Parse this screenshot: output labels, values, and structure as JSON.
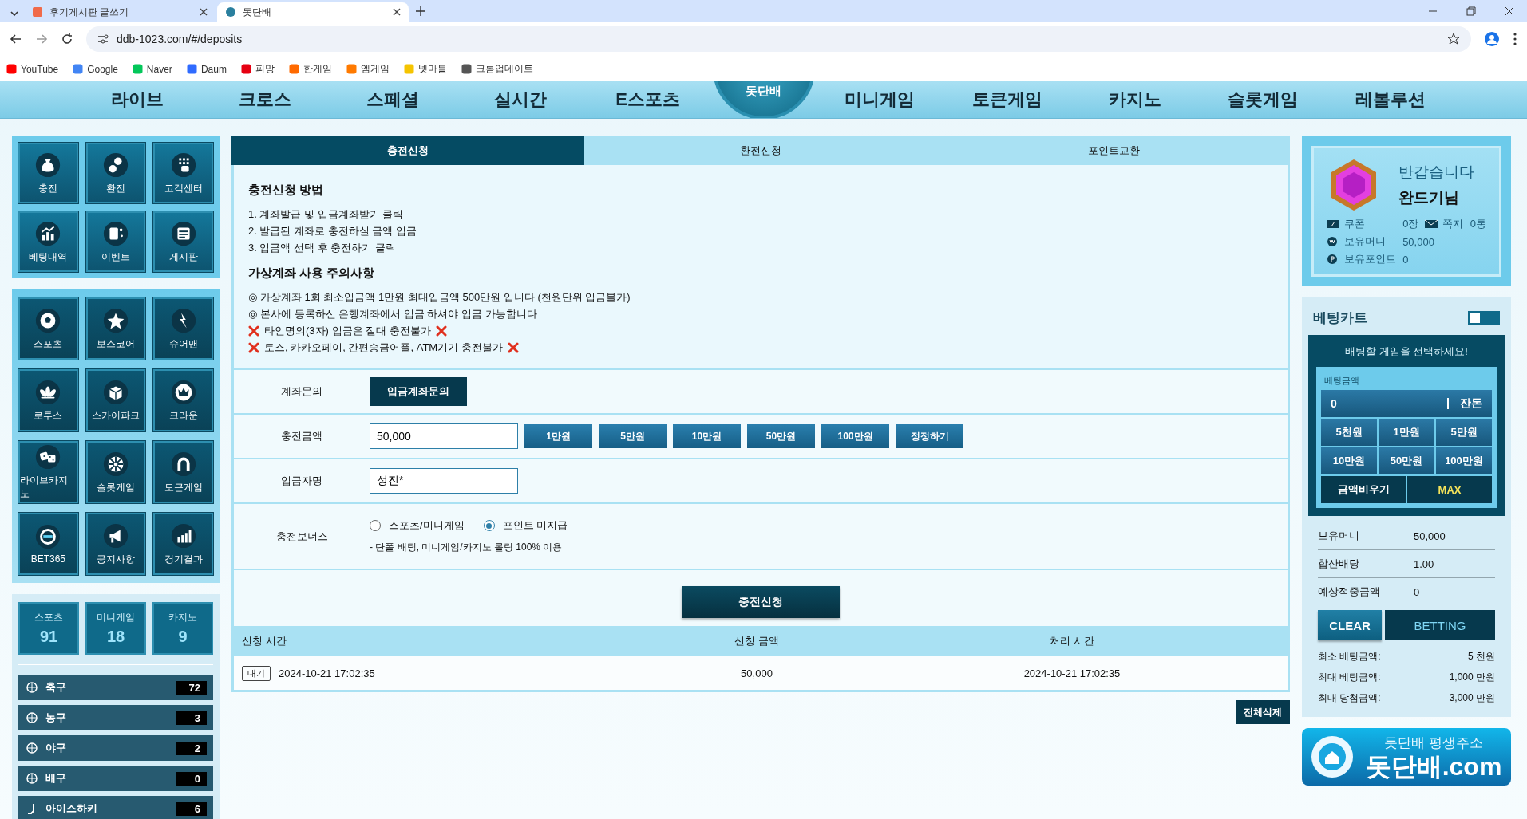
{
  "browser": {
    "tabs": [
      {
        "title": "후기게시판 글쓰기",
        "selected": false
      },
      {
        "title": "돗단배",
        "selected": true
      }
    ],
    "url": "ddb-1023.com/#/deposits",
    "bookmarks": [
      "YouTube",
      "Google",
      "Naver",
      "Daum",
      "피망",
      "한게임",
      "엠게임",
      "넷마블",
      "크롬업데이트"
    ]
  },
  "nav": {
    "items_left": [
      "라이브",
      "크로스",
      "스페셜",
      "실시간",
      "E스포츠"
    ],
    "logo": "돗단배",
    "items_right": [
      "미니게임",
      "토큰게임",
      "카지노",
      "슬롯게임",
      "레볼루션"
    ]
  },
  "sidebar": {
    "menu": [
      "충전",
      "환전",
      "고객센터",
      "베팅내역",
      "이벤트",
      "게시판"
    ],
    "games": [
      "스포츠",
      "보스코어",
      "슈어맨",
      "로투스",
      "스카이파크",
      "크라운",
      "라이브카지노",
      "슬롯게임",
      "토큰게임",
      "BET365",
      "공지사항",
      "경기결과"
    ],
    "counts": [
      {
        "label": "스포츠",
        "value": "91"
      },
      {
        "label": "미니게임",
        "value": "18"
      },
      {
        "label": "카지노",
        "value": "9"
      }
    ],
    "sports": [
      {
        "name": "축구",
        "count": "72"
      },
      {
        "name": "농구",
        "count": "3"
      },
      {
        "name": "야구",
        "count": "2"
      },
      {
        "name": "배구",
        "count": "0"
      },
      {
        "name": "아이스하키",
        "count": "6"
      }
    ]
  },
  "tabs": [
    {
      "label": "충전신청",
      "selected": true
    },
    {
      "label": "환전신청",
      "selected": false
    },
    {
      "label": "포인트교환",
      "selected": false
    }
  ],
  "guide": {
    "title": "충전신청 방법",
    "steps": [
      "1. 계좌발급 및 입금계좌받기 클릭",
      "2. 발급된 계좌로 충전하실 금액 입금",
      "3. 입금액 선택 후 충전하기 클릭"
    ],
    "notice_title": "가상계좌 사용 주의사항",
    "notices": [
      {
        "kind": "info",
        "text": "◎ 가상계좌 1회 최소입금액 1만원 최대입금액 500만원 입니다 (천원단위 입금불가)"
      },
      {
        "kind": "info",
        "text": "◎ 본사에 등록하신 은행계좌에서 입금 하셔야 입금 가능합니다"
      },
      {
        "kind": "warning",
        "text": "타인명의(3자) 입금은 절대 충전불가"
      },
      {
        "kind": "warning",
        "text": "토스, 카카오페이, 간편송금어플, ATM기기 충전불가"
      }
    ]
  },
  "form": [
    {
      "kind": "button",
      "label": "계좌문의",
      "button": "입금계좌문의"
    },
    {
      "kind": "amount",
      "label": "충전금액",
      "value": "50,000",
      "buttons": [
        "1만원",
        "5만원",
        "10만원",
        "50만원",
        "100만원",
        "정정하기"
      ]
    },
    {
      "kind": "text",
      "label": "입금자명",
      "value": "성진*"
    },
    {
      "kind": "radio",
      "label": "충전보너스",
      "options": [
        {
          "label": "스포츠/미니게임",
          "selected": false
        },
        {
          "label": "포인트 미지급",
          "selected": true
        }
      ],
      "note": "- 단폴 배팅, 미니게임/카지노 롤링 100% 이용"
    }
  ],
  "submit": "충전신청",
  "history": {
    "columns": [
      "신청 시간",
      "신청 금액",
      "처리 시간"
    ],
    "rows": [
      {
        "status": "대기",
        "requested": "2024-10-21 17:02:35",
        "amount": "50,000",
        "processed": "2024-10-21 17:02:35"
      }
    ]
  },
  "delete_all": "전체삭제",
  "profile": {
    "greeting": "반갑습니다",
    "name": "완드기님",
    "coupon_label": "쿠폰",
    "coupon": "0장",
    "message_label": "쪽지",
    "messages": "0통",
    "money_label": "보유머니",
    "money": "50,000",
    "points_label": "보유포인트",
    "points": "0"
  },
  "cart": {
    "title": "베팅카트",
    "on": false,
    "prompt": "배팅할 게임을 선택하세요!",
    "amount_label": "베팅금액",
    "amount": "0",
    "change": "잔돈",
    "chips": [
      "5천원",
      "1만원",
      "5만원",
      "10만원",
      "50만원",
      "100만원"
    ],
    "clear_amount": "금액비우기",
    "max": "MAX",
    "summary": [
      {
        "label": "보유머니",
        "value": "50,000"
      },
      {
        "label": "합산배당",
        "value": "1.00"
      },
      {
        "label": "예상적중금액",
        "value": "0"
      }
    ],
    "clear": "CLEAR",
    "bet": "BETTING",
    "limits": [
      {
        "label": "최소 베팅금액:",
        "value": "5 천원"
      },
      {
        "label": "최대 베팅금액:",
        "value": "1,000 만원"
      },
      {
        "label": "최대 당첨금액:",
        "value": "3,000 만원"
      }
    ]
  },
  "banner": {
    "line1": "돗단배 평생주소",
    "line2": "돗단배.com"
  }
}
